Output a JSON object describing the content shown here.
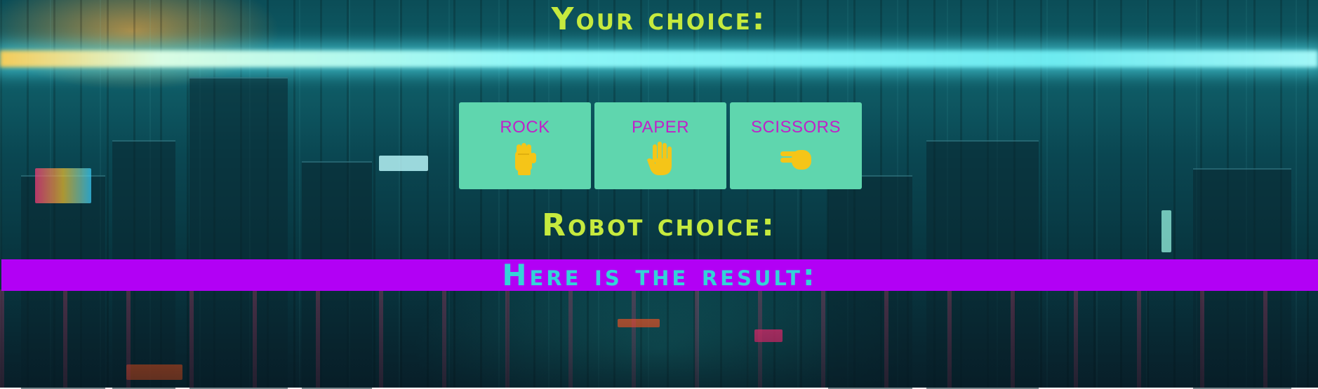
{
  "header": {
    "your_choice_label": "Your choice:"
  },
  "choices": [
    {
      "label": "ROCK",
      "icon": "raised-fist-icon"
    },
    {
      "label": "PAPER",
      "icon": "raised-hand-icon"
    },
    {
      "label": "SCISSORS",
      "icon": "pointing-hand-icon"
    }
  ],
  "robot": {
    "robot_choice_label": "Robot choice:"
  },
  "result": {
    "result_label": "Here is the result:"
  },
  "colors": {
    "heading": "#c6ea3e",
    "button_bg": "#5fd6ae",
    "button_text": "#c021c8",
    "icon": "#f5c518",
    "result_banner": "#b200f5",
    "result_text": "#34d2d8"
  }
}
